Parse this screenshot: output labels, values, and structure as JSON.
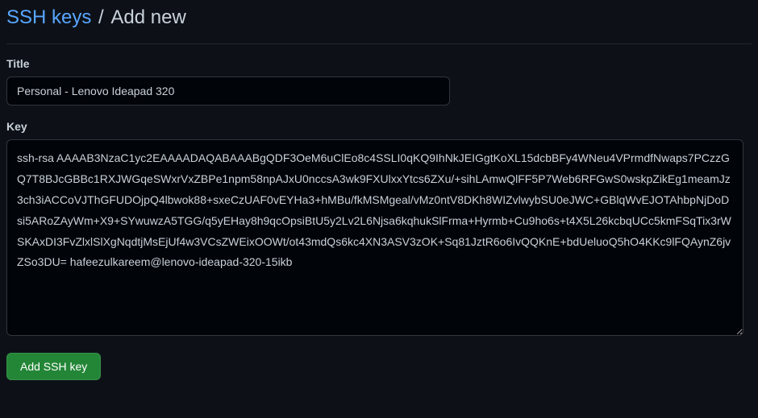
{
  "breadcrumb": {
    "parent": "SSH keys",
    "current": "Add new"
  },
  "form": {
    "title_label": "Title",
    "title_value": "Personal - Lenovo Ideapad 320",
    "key_label": "Key",
    "key_value": "ssh-rsa AAAAB3NzaC1yc2EAAAADAQABAAABgQDF3OeM6uClEo8c4SSLI0qKQ9IhNkJEIGgtKoXL15dcbBFy4WNeu4VPrmdfNwaps7PCzzGQ7T8BJcGBBc1RXJWGqeSWxrVxZBPe1npm58npAJxU0nccsA3wk9FXUlxxYtcs6ZXu/+sihLAmwQlFF5P7Web6RFGwS0wskpZikEg1meamJz3ch3iACCoVJThGFUDOjpQ4lbwok88+sxeCzUAF0vEYHa3+hMBu/fkMSMgeal/vMz0ntV8DKh8WIZvlwybSU0eJWC+GBlqWvEJOTAhbpNjDoDsi5ARoZAyWm+X9+SYwuwzA5TGG/q5yEHay8h9qcOpsiBtU5y2Lv2L6Njsa6kqhukSlFrma+Hyrmb+Cu9ho6s+t4X5L26kcbqUCc5kmFSqTix3rWSKAxDI3FvZlxlSlXgNqdtjMsEjUf4w3VCsZWEixOOWt/ot43mdQs6kc4XN3ASV3zOK+Sq81JztR6o6IvQQKnE+bdUeluoQ5hO4KKc9lFQAynZ6jvZSo3DU= hafeezulkareem@lenovo-ideapad-320-15ikb",
    "submit_label": "Add SSH key"
  }
}
